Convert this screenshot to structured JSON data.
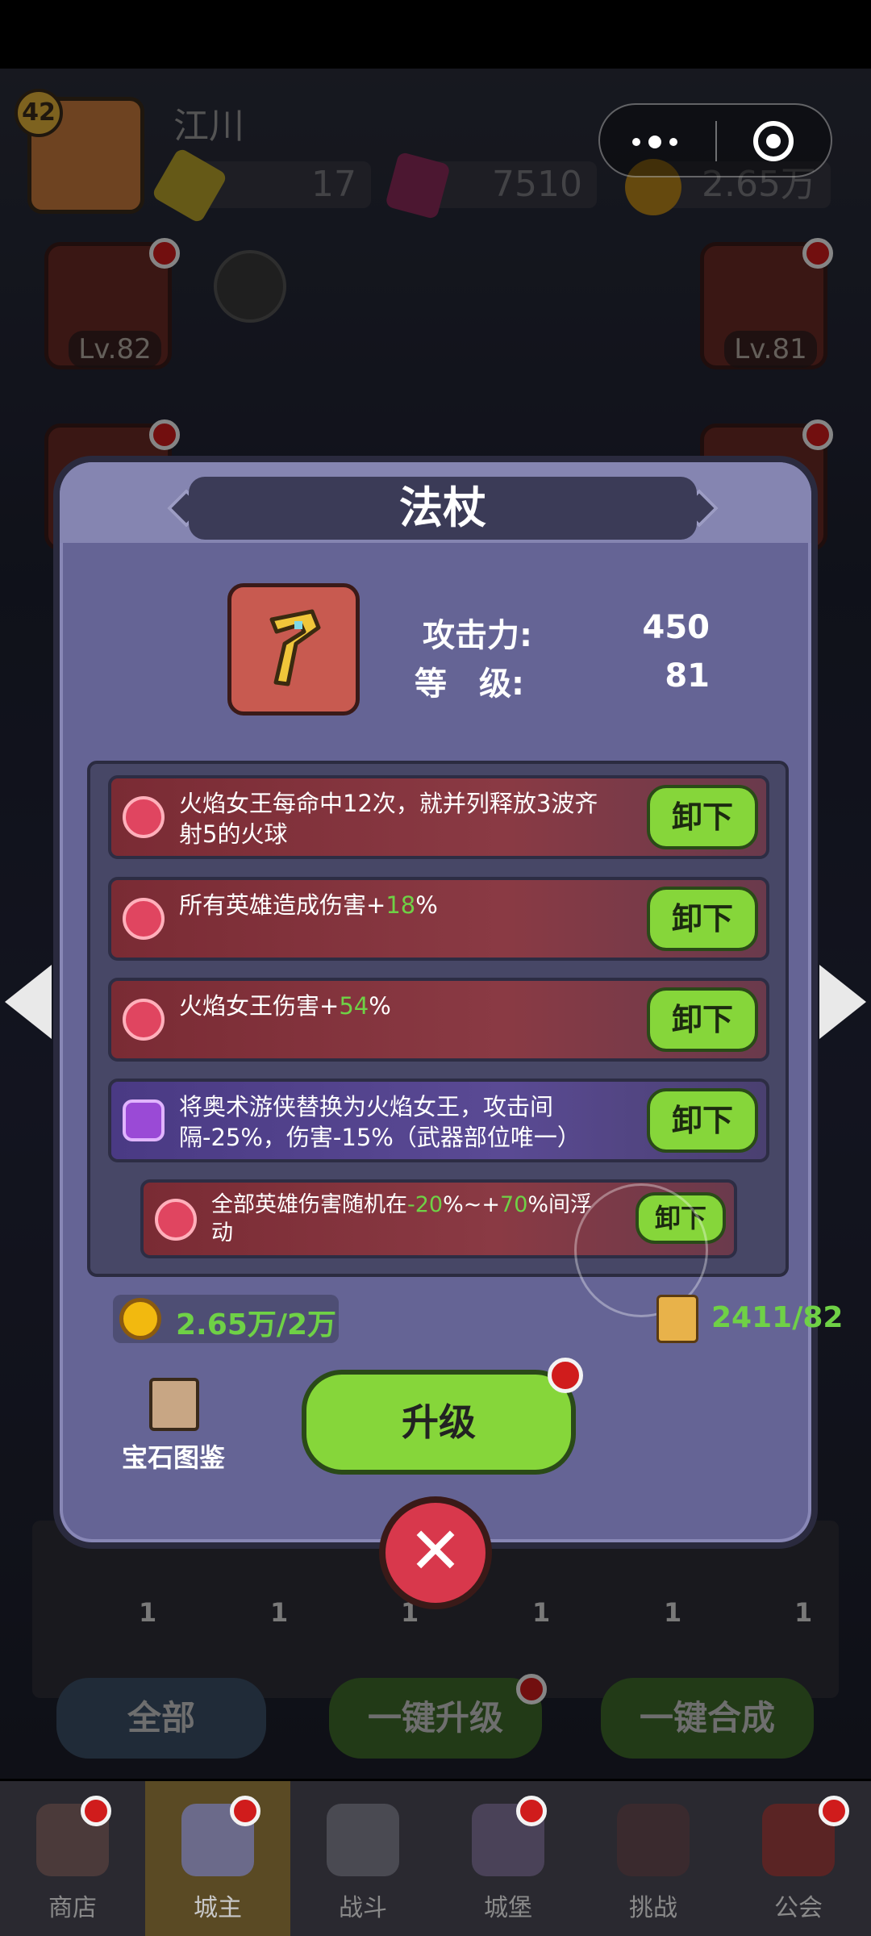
{
  "player": {
    "level": "42",
    "name": "江川"
  },
  "resources": [
    {
      "icon": "gem-yellow-icon",
      "value": "17"
    },
    {
      "icon": "gem-purple-icon",
      "value": "7510"
    },
    {
      "icon": "coin-icon",
      "value": "2.65万"
    }
  ],
  "equip_slots": {
    "crown_level": "Lv.82",
    "staff_level": "Lv.81"
  },
  "modal": {
    "title": "法杖",
    "attack_label": "攻击力:",
    "attack_value": "450",
    "level_label": "等　级:",
    "level_value": "81",
    "gems": [
      {
        "pre": "火焰女王每命中12次，就并列释放3波齐射5的火球",
        "hl": "",
        "post": "",
        "button": "卸下",
        "type": "red"
      },
      {
        "pre": "所有英雄造成伤害+",
        "hl": "18",
        "post": "%",
        "button": "卸下",
        "type": "red"
      },
      {
        "pre": "火焰女王伤害+",
        "hl": "54",
        "post": "%",
        "button": "卸下",
        "type": "red"
      },
      {
        "pre": "将奥术游侠替换为火焰女王，攻击间隔-25%，伤害-15%（武器部位唯一）",
        "hl": "",
        "post": "",
        "button": "卸下",
        "type": "purple"
      }
    ],
    "extra_gem": {
      "t1": "全部英雄伤害随机在",
      "h1": "-20",
      "t2": "%~+",
      "h2": "70",
      "t3": "%间浮动",
      "button": "卸下"
    },
    "gold_cost": "2.65万/2万",
    "scroll_cost": "2411/82",
    "codex_label": "宝石图鉴",
    "upgrade_label": "升级"
  },
  "background_buttons": {
    "all": "全部",
    "one_key_upgrade": "一键升级",
    "one_key_merge": "一键合成"
  },
  "inventory_counts": [
    "1",
    "1",
    "1",
    "1",
    "1",
    "1"
  ],
  "nav": [
    {
      "label": "商店",
      "icon": "shop-icon"
    },
    {
      "label": "城主",
      "icon": "lord-icon"
    },
    {
      "label": "战斗",
      "icon": "battle-icon"
    },
    {
      "label": "城堡",
      "icon": "castle-icon"
    },
    {
      "label": "挑战",
      "icon": "challenge-icon"
    },
    {
      "label": "公会",
      "icon": "guild-icon"
    }
  ],
  "colors": {
    "accent_green": "#86d63a",
    "highlight_green": "#6fd146",
    "panel": "#656495",
    "badge_red": "#d01c1c"
  }
}
